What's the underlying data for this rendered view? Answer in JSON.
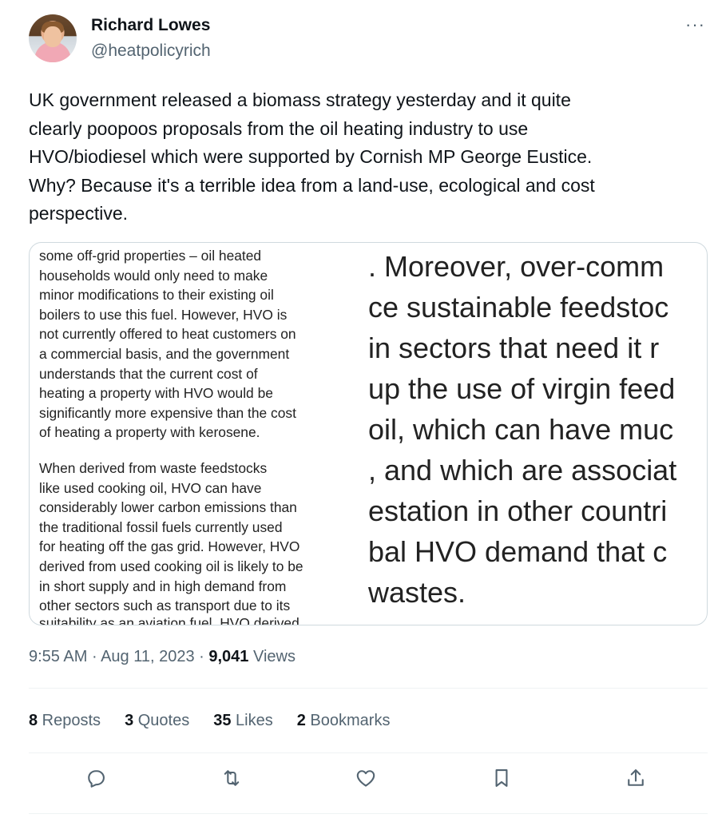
{
  "author": {
    "name": "Richard Lowes",
    "handle": "@heatpolicyrich"
  },
  "more_glyph": "···",
  "tweet": {
    "lines": [
      "UK government released a biomass strategy yesterday and it quite",
      "clearly poopoos proposals from the oil heating industry to use",
      "HVO/biodiesel which were supported by Cornish MP George Eustice.",
      "Why? Because it's a terrible idea from a land-use, ecological and cost",
      "perspective."
    ]
  },
  "media": {
    "left_para1": [
      "some off-grid properties – oil heated",
      "households would only need to make",
      "minor modifications to their existing oil",
      "boilers to use this fuel. However, HVO is",
      "not currently offered to heat customers on",
      "a commercial basis, and the government",
      "understands that the current cost of",
      "heating a property with HVO would be",
      "significantly more expensive than the cost",
      "of heating a property with kerosene."
    ],
    "left_para2": [
      "When derived from waste feedstocks",
      "like used cooking oil, HVO can have",
      "considerably lower carbon emissions than",
      "the traditional fossil fuels currently used",
      "for heating off the gas grid. However, HVO",
      "derived from used cooking oil is likely to be",
      "in short supply and in high demand from",
      "other sectors such as transport due to its"
    ],
    "left_cut": "suitability as an aviation fuel. HVO derived",
    "right_lines": [
      ". Moreover, over-comm",
      "ce sustainable feedstoc",
      " in sectors that need it r",
      "up the use of virgin feed",
      "oil, which can have muc",
      ", and which are associat",
      "estation in other countri",
      "bal HVO demand that c",
      "wastes."
    ]
  },
  "meta": {
    "time": "9:55 AM",
    "sep1": " · ",
    "date": "Aug 11, 2023",
    "sep2": " · ",
    "views_count": "9,041",
    "views_label": " Views"
  },
  "stats": {
    "reposts": {
      "count": "8",
      "label": " Reposts"
    },
    "quotes": {
      "count": "3",
      "label": " Quotes"
    },
    "likes": {
      "count": "35",
      "label": " Likes"
    },
    "bookmarks": {
      "count": "2",
      "label": " Bookmarks"
    }
  },
  "icons": {
    "reply": "reply-icon",
    "repost": "repost-icon",
    "like": "heart-icon",
    "bookmark": "bookmark-icon",
    "share": "share-icon",
    "color": "#536471"
  }
}
